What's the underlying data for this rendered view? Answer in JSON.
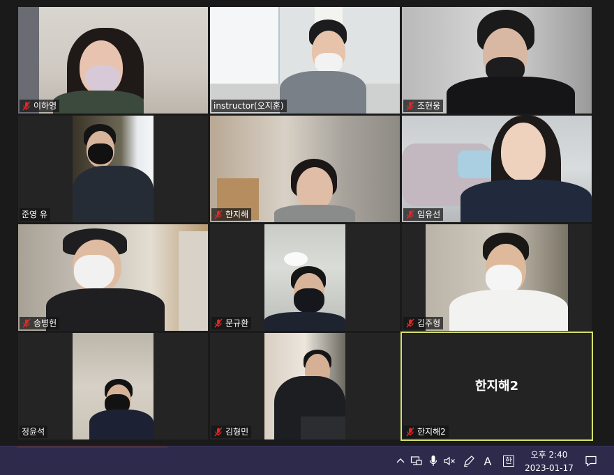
{
  "participants": [
    {
      "name": "이하영",
      "muted": true
    },
    {
      "name": "instructor(오지훈)",
      "muted": false
    },
    {
      "name": "조현웅",
      "muted": true
    },
    {
      "name": "준영 유",
      "muted": false
    },
    {
      "name": "한지해",
      "muted": true
    },
    {
      "name": "임유선",
      "muted": true
    },
    {
      "name": "송병헌",
      "muted": true
    },
    {
      "name": "문규환",
      "muted": true
    },
    {
      "name": "김주형",
      "muted": true
    },
    {
      "name": "정윤석",
      "muted": false
    },
    {
      "name": "김형민",
      "muted": true
    },
    {
      "name": "한지해2",
      "muted": true,
      "video_off": true,
      "display_name": "한지해2",
      "active_speaker": true
    }
  ],
  "taskbar": {
    "tray_icons": [
      "chevron-up-icon",
      "network-icon",
      "microphone-icon",
      "speaker-muted-icon",
      "pen-icon",
      "font-icon",
      "ime-icon",
      "notification-icon"
    ],
    "font_label": "A",
    "ime_label": "한",
    "time": "오후 2:40",
    "date": "2023-01-17"
  },
  "colors": {
    "active_border": "#d7e36a",
    "taskbar_bg": "#2d2a4c",
    "grid_bg": "#1a1a1a",
    "mic_off_red": "#e02828"
  }
}
